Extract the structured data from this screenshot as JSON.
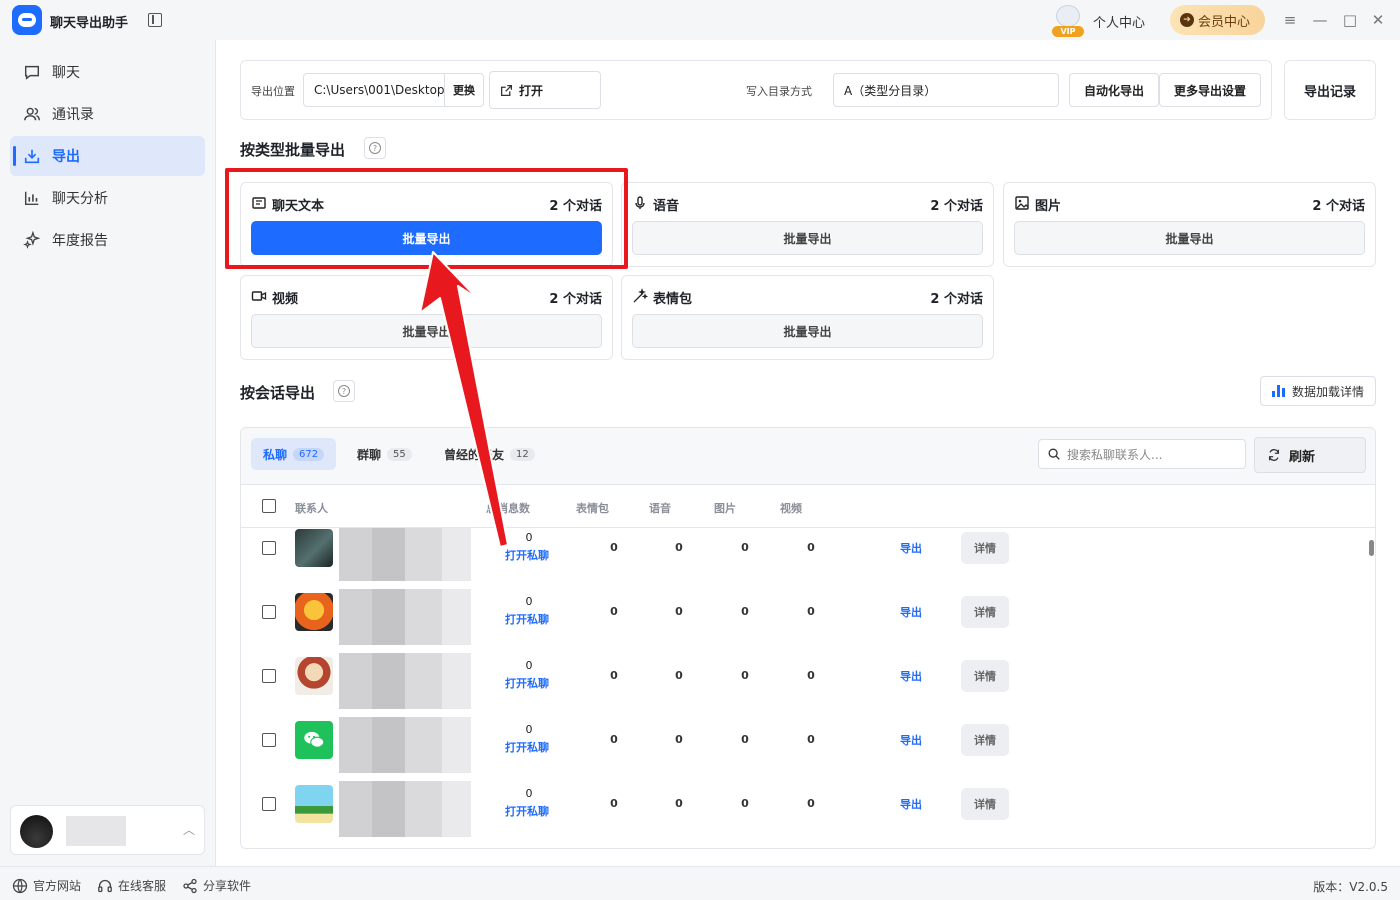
{
  "app": {
    "title": "聊天导出助手"
  },
  "titlebar": {
    "vip_tag": "VIP",
    "personal_center": "个人中心",
    "member_center": "会员中心",
    "controls": [
      "menu-icon",
      "minimize-icon",
      "maximize-icon",
      "close-icon"
    ]
  },
  "sidebar": {
    "items": [
      {
        "label": "聊天",
        "icon": "chat-icon"
      },
      {
        "label": "通讯录",
        "icon": "contacts-icon"
      },
      {
        "label": "导出",
        "icon": "export-icon",
        "active": true
      },
      {
        "label": "聊天分析",
        "icon": "analysis-icon"
      },
      {
        "label": "年度报告",
        "icon": "sparkle-icon"
      }
    ]
  },
  "footer": {
    "links": [
      "官方网站",
      "在线客服",
      "分享软件"
    ],
    "version": "版本：V2.0.5"
  },
  "export_bar": {
    "location_label": "导出位置",
    "location_value": "C:\\Users\\001\\Desktop",
    "change_button": "更换",
    "open_button": "打开",
    "dir_mode_label": "写入目录方式",
    "dir_mode_value": "A（类型分目录）",
    "auto_export_button": "自动化导出",
    "more_settings_button": "更多导出设置",
    "export_log_button": "导出记录"
  },
  "batch_section": {
    "title": "按类型批量导出",
    "cards": [
      {
        "name": "聊天文本",
        "count": "2 个对话",
        "button": "批量导出",
        "icon": "text-icon"
      },
      {
        "name": "语音",
        "count": "2 个对话",
        "button": "批量导出",
        "icon": "microphone-icon"
      },
      {
        "name": "图片",
        "count": "2 个对话",
        "button": "批量导出",
        "icon": "image-icon"
      },
      {
        "name": "视频",
        "count": "2 个对话",
        "button": "批量导出",
        "icon": "video-icon"
      },
      {
        "name": "表情包",
        "count": "2 个对话",
        "button": "批量导出",
        "icon": "magic-wand-icon"
      }
    ]
  },
  "session_section": {
    "title": "按会话导出",
    "data_detail_button": "数据加载详情",
    "tabs": [
      {
        "label": "私聊",
        "count": "672"
      },
      {
        "label": "群聊",
        "count": "55"
      },
      {
        "label": "曾经的好友",
        "count": "12"
      }
    ],
    "search_placeholder": "搜索私聊联系人...",
    "refresh_button": "刷新",
    "columns": [
      "联系人",
      "总消息数",
      "表情包",
      "语音",
      "图片",
      "视频"
    ],
    "rows": [
      {
        "total": "0",
        "open": "打开私聊",
        "emoji": "0",
        "voice": "0",
        "image": "0",
        "video": "0",
        "export": "导出",
        "detail": "详情"
      },
      {
        "total": "0",
        "open": "打开私聊",
        "emoji": "0",
        "voice": "0",
        "image": "0",
        "video": "0",
        "export": "导出",
        "detail": "详情"
      },
      {
        "total": "0",
        "open": "打开私聊",
        "emoji": "0",
        "voice": "0",
        "image": "0",
        "video": "0",
        "export": "导出",
        "detail": "详情"
      },
      {
        "total": "0",
        "open": "打开私聊",
        "emoji": "0",
        "voice": "0",
        "image": "0",
        "video": "0",
        "export": "导出",
        "detail": "详情"
      },
      {
        "total": "0",
        "open": "打开私聊",
        "emoji": "0",
        "voice": "0",
        "image": "0",
        "video": "0",
        "export": "导出",
        "detail": "详情"
      }
    ]
  },
  "colors": {
    "accent": "#1d6bff",
    "highlight": "#e8191e"
  }
}
